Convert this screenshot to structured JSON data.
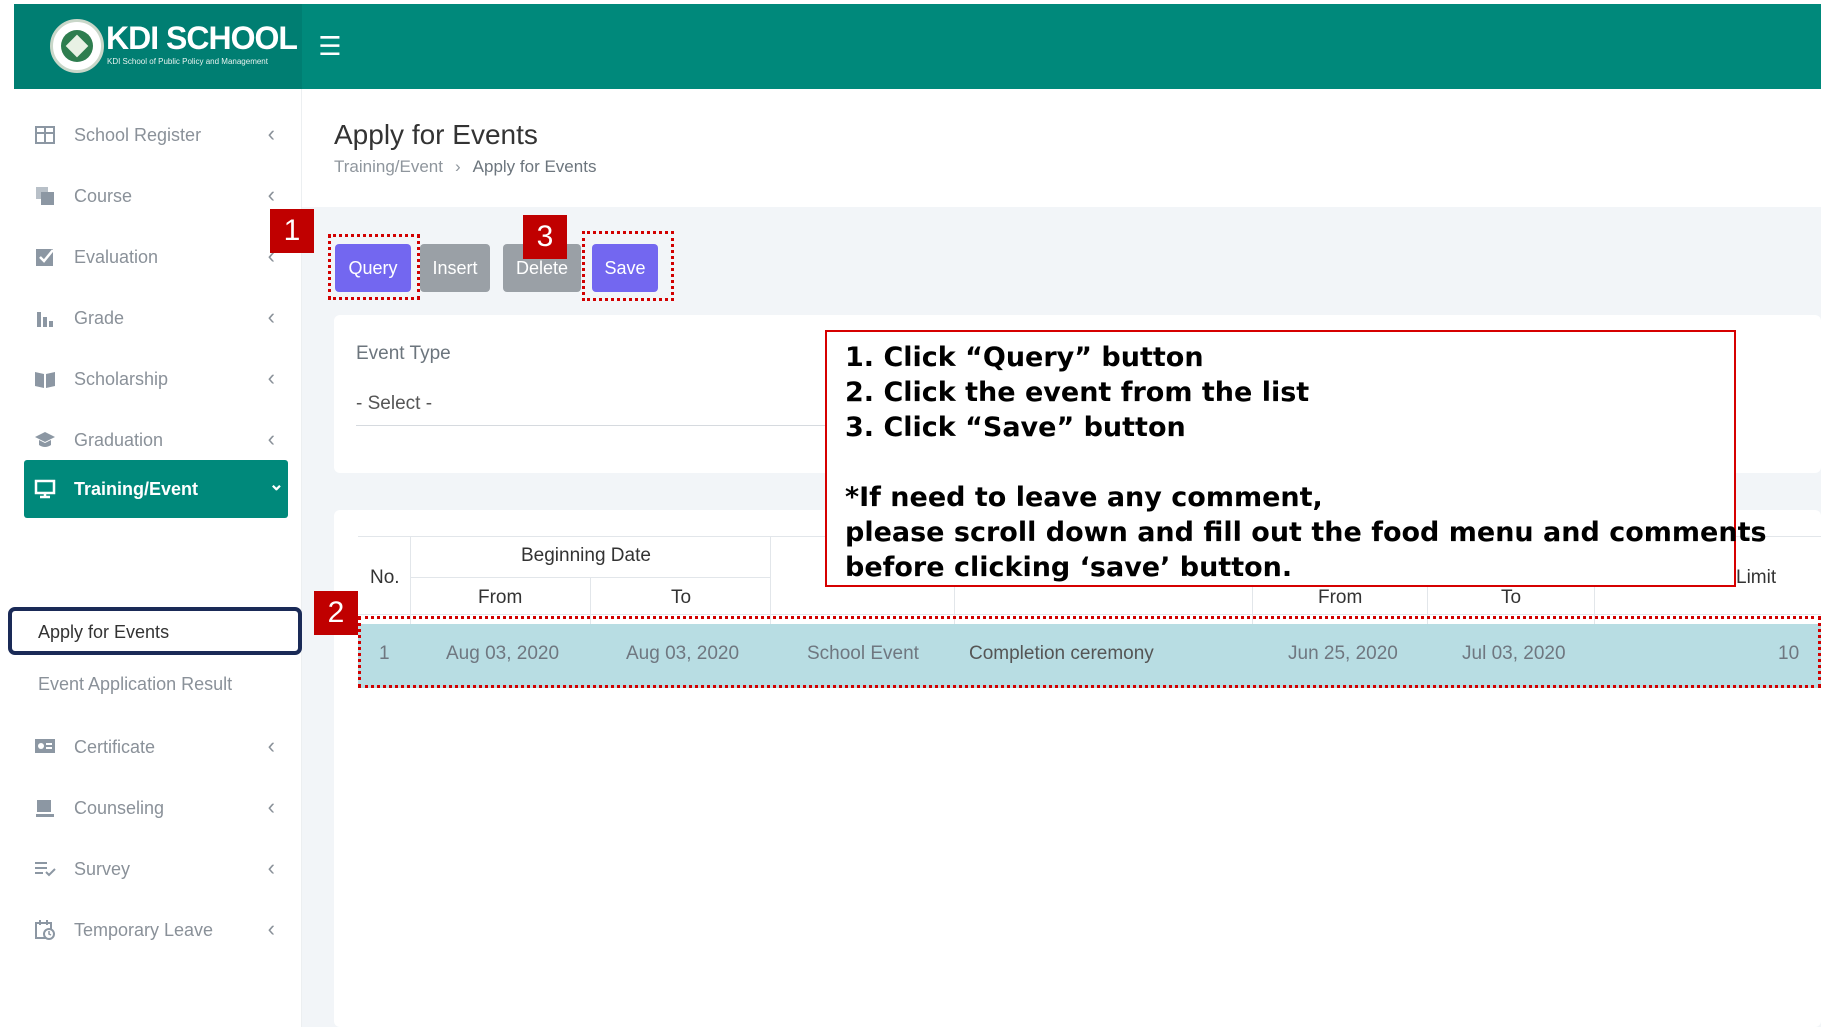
{
  "brand": {
    "title": "KDI SCHOOL",
    "subtitle": "KDI School of Public Policy and Management"
  },
  "sidebar": {
    "items": [
      {
        "label": "School Register",
        "icon": "table-icon"
      },
      {
        "label": "Course",
        "icon": "copy-icon"
      },
      {
        "label": "Evaluation",
        "icon": "check-square-icon"
      },
      {
        "label": "Grade",
        "icon": "bar-chart-icon"
      },
      {
        "label": "Scholarship",
        "icon": "book-icon"
      },
      {
        "label": "Graduation",
        "icon": "graduation-cap-icon"
      },
      {
        "label": "Training/Event",
        "icon": "monitor-icon"
      },
      {
        "label": "Certificate",
        "icon": "certificate-icon"
      },
      {
        "label": "Counseling",
        "icon": "coffee-icon"
      },
      {
        "label": "Survey",
        "icon": "list-check-icon"
      },
      {
        "label": "Temporary Leave",
        "icon": "calendar-clock-icon"
      }
    ],
    "sub_items": [
      {
        "label": "Apply for Events"
      },
      {
        "label": "Event Application Result"
      }
    ]
  },
  "page": {
    "title": "Apply for Events",
    "breadcrumb": [
      "Training/Event",
      "Apply for Events"
    ]
  },
  "toolbar": {
    "query": "Query",
    "insert": "Insert",
    "delete": "Delete",
    "save": "Save"
  },
  "filter": {
    "label": "Event Type",
    "value": "- Select -"
  },
  "table": {
    "headers": {
      "no": "No.",
      "beginning_date": "Beginning Date",
      "from": "From",
      "to": "To",
      "app_from": "From",
      "app_to": "To",
      "limit": "Limit"
    },
    "rows": [
      {
        "no": "1",
        "begin_from": "Aug 03, 2020",
        "begin_to": "Aug 03, 2020",
        "type": "School Event",
        "name": "Completion ceremony",
        "app_from": "Jun 25, 2020",
        "app_to": "Jul 03, 2020",
        "limit": "10"
      }
    ]
  },
  "annotations": {
    "badges": [
      "1",
      "2",
      "3"
    ],
    "instructions": [
      "1.   Click “Query” button",
      "2.   Click the event from the list",
      "3.   Click “Save” button",
      "",
      "*If need to leave any comment,",
      "please scroll down and fill out the food menu and comments",
      "before clicking ‘save’ button."
    ]
  },
  "colors": {
    "topbar": "#00897b",
    "primary_button": "#7367f0",
    "annotation_red": "#c00000",
    "selected_row": "#b8dde3"
  }
}
